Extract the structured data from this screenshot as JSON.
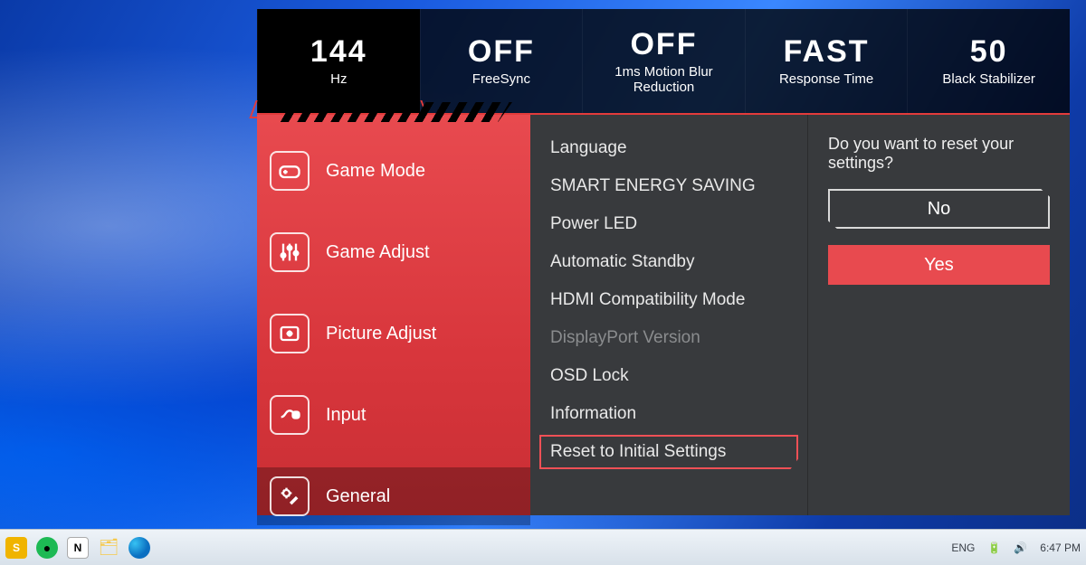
{
  "status_bar": [
    {
      "value": "144",
      "label": "Hz"
    },
    {
      "value": "OFF",
      "label": "FreeSync"
    },
    {
      "value": "OFF",
      "label": "1ms Motion Blur Reduction"
    },
    {
      "value": "FAST",
      "label": "Response Time"
    },
    {
      "value": "50",
      "label": "Black Stabilizer"
    }
  ],
  "menu": {
    "items": [
      {
        "label": "Game Mode"
      },
      {
        "label": "Game Adjust"
      },
      {
        "label": "Picture Adjust"
      },
      {
        "label": "Input"
      },
      {
        "label": "General"
      }
    ],
    "active_index": 4
  },
  "submenu": {
    "items": [
      {
        "label": "Language"
      },
      {
        "label": "SMART ENERGY SAVING"
      },
      {
        "label": "Power LED"
      },
      {
        "label": "Automatic Standby"
      },
      {
        "label": "HDMI Compatibility Mode"
      },
      {
        "label": "DisplayPort Version",
        "disabled": true
      },
      {
        "label": "OSD Lock"
      },
      {
        "label": "Information"
      },
      {
        "label": "Reset to Initial Settings",
        "selected": true
      }
    ]
  },
  "confirm": {
    "question": "Do you want to reset your settings?",
    "no": "No",
    "yes": "Yes"
  },
  "taskbar": {
    "lang": "ENG",
    "time": "6:47 PM"
  }
}
